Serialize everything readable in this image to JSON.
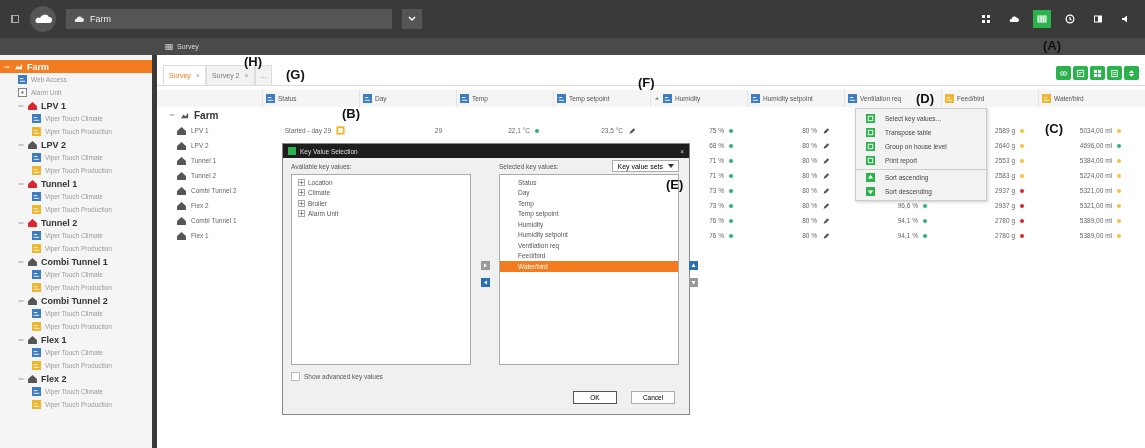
{
  "topbar": {
    "location": "Farm",
    "icons": [
      {
        "kind": "grid",
        "selected": false
      },
      {
        "kind": "cloud",
        "selected": false
      },
      {
        "kind": "table",
        "selected": true
      },
      {
        "kind": "history",
        "selected": false
      },
      {
        "kind": "panel",
        "selected": false
      },
      {
        "kind": "speaker",
        "selected": false
      }
    ]
  },
  "panel_title": "Survey",
  "sidebar": {
    "items": [
      {
        "label": "Farm",
        "kind": "farm",
        "selected": true,
        "expanded": true,
        "children": [
          {
            "label": "Web Access",
            "kind": "web",
            "selected": false
          },
          {
            "label": "Alarm Unit",
            "kind": "alarm",
            "selected": false
          },
          {
            "label": "LPV 1",
            "kind": "house",
            "color": "#d9262e",
            "selected": false,
            "expanded": true,
            "children": [
              {
                "label": "Viper Touch Climate",
                "kind": "climate",
                "selected": false
              },
              {
                "label": "Viper Touch Production",
                "kind": "production",
                "selected": false
              }
            ]
          },
          {
            "label": "LPV 2",
            "kind": "house",
            "color": "#555555",
            "selected": false,
            "expanded": true,
            "children": [
              {
                "label": "Viper Touch Climate",
                "kind": "climate",
                "selected": false
              },
              {
                "label": "Viper Touch Production",
                "kind": "production",
                "selected": false
              }
            ]
          },
          {
            "label": "Tunnel 1",
            "kind": "house",
            "color": "#d9262e",
            "selected": false,
            "expanded": true,
            "children": [
              {
                "label": "Viper Touch Climate",
                "kind": "climate",
                "selected": false
              },
              {
                "label": "Viper Touch Production",
                "kind": "production",
                "selected": false
              }
            ]
          },
          {
            "label": "Tunnel 2",
            "kind": "house",
            "color": "#d9262e",
            "selected": false,
            "expanded": true,
            "children": [
              {
                "label": "Viper Touch Climate",
                "kind": "climate",
                "selected": false
              },
              {
                "label": "Viper Touch Production",
                "kind": "production",
                "selected": false
              }
            ]
          },
          {
            "label": "Combi Tunnel 1",
            "kind": "house",
            "color": "#555555",
            "selected": false,
            "expanded": true,
            "children": [
              {
                "label": "Viper Touch Climate",
                "kind": "climate",
                "selected": false
              },
              {
                "label": "Viper Touch Production",
                "kind": "production",
                "selected": false
              }
            ]
          },
          {
            "label": "Combi Tunnel 2",
            "kind": "house",
            "color": "#555555",
            "selected": false,
            "expanded": true,
            "children": [
              {
                "label": "Viper Touch Climate",
                "kind": "climate",
                "selected": false
              },
              {
                "label": "Viper Touch Production",
                "kind": "production",
                "selected": false
              }
            ]
          },
          {
            "label": "Flex 1",
            "kind": "house",
            "color": "#555555",
            "selected": false,
            "expanded": true,
            "children": [
              {
                "label": "Viper Touch Climate",
                "kind": "climate",
                "selected": false
              },
              {
                "label": "Viper Touch Production",
                "kind": "production",
                "selected": false
              }
            ]
          },
          {
            "label": "Flex 2",
            "kind": "house",
            "color": "#555555",
            "selected": false,
            "expanded": true,
            "children": [
              {
                "label": "Viper Touch Climate",
                "kind": "climate",
                "selected": false
              },
              {
                "label": "Viper Touch Production",
                "kind": "production",
                "selected": false
              }
            ]
          }
        ]
      }
    ]
  },
  "tabs": [
    {
      "label": "Survey",
      "selected": true,
      "close": "×"
    },
    {
      "label": "Survey 2",
      "selected": false,
      "close": "×"
    },
    {
      "label": "...",
      "selected": false
    }
  ],
  "toolbar": [
    {
      "kind": "view"
    },
    {
      "kind": "transpose"
    },
    {
      "kind": "group"
    },
    {
      "kind": "print"
    },
    {
      "kind": "sort"
    }
  ],
  "table": {
    "columns": [
      {
        "label": "Status",
        "kind": "climate"
      },
      {
        "label": "Day",
        "kind": "climate"
      },
      {
        "label": "Temp",
        "kind": "climate"
      },
      {
        "label": "Temp setpoint",
        "kind": "climate"
      },
      {
        "label": "Humidity",
        "kind": "climate",
        "sorted": true
      },
      {
        "label": "Humidity setpoint",
        "kind": "climate"
      },
      {
        "label": "Ventilation req",
        "kind": "climate"
      },
      {
        "label": "Feed/bird",
        "kind": "production"
      },
      {
        "label": "Water/bird",
        "kind": "production"
      }
    ],
    "group": {
      "label": "Farm",
      "expanded": true
    },
    "rows": [
      {
        "name": "LPV 1",
        "cells": [
          {
            "text": "Started - day 29",
            "kind": "alert"
          },
          {
            "text": "29"
          },
          {
            "text": "22,1 °C",
            "color": "#2bb673"
          },
          {
            "text": "23,5 °C",
            "kind": "edit"
          },
          {
            "text": "75 %",
            "color": "#2bb673"
          },
          {
            "text": "80 %",
            "kind": "edit"
          },
          null,
          {
            "text": "2589 g",
            "color": "#f5c242"
          },
          {
            "text": "5034,00 ml",
            "color": "#f5c242"
          }
        ]
      },
      {
        "name": "LPV 2",
        "cells": [
          null,
          null,
          null,
          null,
          {
            "text": "68 %",
            "color": "#2bb673"
          },
          {
            "text": "80 %",
            "kind": "edit"
          },
          null,
          {
            "text": "2640 g",
            "color": "#f5c242"
          },
          {
            "text": "4696,00 ml",
            "color": "#2bb673"
          }
        ]
      },
      {
        "name": "Tunnel 1",
        "cells": [
          null,
          null,
          null,
          null,
          {
            "text": "71 %",
            "color": "#2bb673"
          },
          {
            "text": "80 %",
            "kind": "edit"
          },
          null,
          {
            "text": "2553 g",
            "color": "#f5c242"
          },
          {
            "text": "5384,00 ml",
            "color": "#f5c242"
          }
        ]
      },
      {
        "name": "Tunnel 2",
        "cells": [
          null,
          null,
          null,
          null,
          {
            "text": "71 %",
            "color": "#2bb673"
          },
          {
            "text": "80 %",
            "kind": "edit"
          },
          null,
          {
            "text": "2583 g",
            "color": "#f5c242"
          },
          {
            "text": "5224,00 ml",
            "color": "#f5c242"
          }
        ]
      },
      {
        "name": "Combi Tunnel 2",
        "cells": [
          null,
          null,
          null,
          null,
          {
            "text": "73 %",
            "color": "#2bb673"
          },
          {
            "text": "80 %",
            "kind": "edit"
          },
          null,
          {
            "text": "2937 g",
            "color": "#d9262e"
          },
          {
            "text": "5321,00 ml",
            "color": "#f5c242"
          }
        ]
      },
      {
        "name": "Flex 2",
        "cells": [
          null,
          null,
          null,
          null,
          {
            "text": "73 %",
            "color": "#2bb673"
          },
          {
            "text": "80 %",
            "kind": "edit"
          },
          {
            "text": "96,6 %",
            "color": "#2bb673"
          },
          {
            "text": "2937 g",
            "color": "#d9262e"
          },
          {
            "text": "5321,00 ml",
            "color": "#f5c242"
          }
        ]
      },
      {
        "name": "Combi Tunnel 1",
        "cells": [
          null,
          null,
          null,
          null,
          {
            "text": "76 %",
            "color": "#2bb673"
          },
          {
            "text": "80 %",
            "kind": "edit"
          },
          {
            "text": "94,1 %",
            "color": "#2bb673"
          },
          {
            "text": "2780 g",
            "color": "#d9262e"
          },
          {
            "text": "5389,00 ml",
            "color": "#f5c242"
          }
        ]
      },
      {
        "name": "Flex 1",
        "cells": [
          null,
          null,
          null,
          null,
          {
            "text": "76 %",
            "color": "#2bb673"
          },
          {
            "text": "80 %",
            "kind": "edit"
          },
          {
            "text": "94,1 %",
            "color": "#2bb673"
          },
          {
            "text": "2780 g",
            "color": "#d9262e"
          },
          {
            "text": "5389,00 ml",
            "color": "#f5c242"
          }
        ]
      }
    ]
  },
  "context_menu": {
    "items": [
      {
        "label": "Select key values...",
        "kind": "view",
        "divider_before": false
      },
      {
        "label": "Transpose table",
        "kind": "transpose",
        "divider_before": false
      },
      {
        "label": "Group on house level",
        "kind": "group",
        "divider_before": false
      },
      {
        "label": "Print report",
        "kind": "print",
        "divider_before": false
      },
      {
        "label": "Sort ascending",
        "kind": "up",
        "divider_before": true
      },
      {
        "label": "Sort descending",
        "kind": "down",
        "divider_before": false
      }
    ]
  },
  "dialog": {
    "title": "Key Value Selection",
    "close": "×",
    "available_label": "Available key values:",
    "available": [
      {
        "label": "Location",
        "expanded": false
      },
      {
        "label": "Climate",
        "expanded": false
      },
      {
        "label": "Broiler",
        "expanded": false
      },
      {
        "label": "Alarm Unit",
        "expanded": false
      }
    ],
    "selected_label": "Selected key values:",
    "sets": "Key value sets",
    "selected_values": [
      {
        "label": "Status",
        "selected": false
      },
      {
        "label": "Day",
        "selected": false
      },
      {
        "label": "Temp",
        "selected": false
      },
      {
        "label": "Temp setpoint",
        "selected": false
      },
      {
        "label": "Humidity",
        "selected": false
      },
      {
        "label": "Humidity setpoint",
        "selected": false
      },
      {
        "label": "Ventilation req",
        "selected": false
      },
      {
        "label": "Feed/bird",
        "selected": false
      },
      {
        "label": "Water/bird",
        "selected": true
      }
    ],
    "move_buttons": [
      {
        "kind": "right",
        "disabled": true
      },
      {
        "kind": "left",
        "disabled": false
      }
    ],
    "order_buttons": [
      {
        "kind": "up",
        "disabled": false
      },
      {
        "kind": "down",
        "disabled": true
      }
    ],
    "advanced": {
      "label": "Show advanced key values",
      "checked": false
    },
    "buttons": [
      {
        "label": "OK",
        "kind": "default"
      },
      {
        "label": "Cancel",
        "kind": "normal"
      }
    ]
  },
  "callouts": [
    {
      "label": "(A)"
    },
    {
      "label": "(B)"
    },
    {
      "label": "(C)"
    },
    {
      "label": "(D)"
    },
    {
      "label": "(E)"
    },
    {
      "label": "(F)"
    },
    {
      "label": "(G)"
    },
    {
      "label": "(H)"
    }
  ]
}
